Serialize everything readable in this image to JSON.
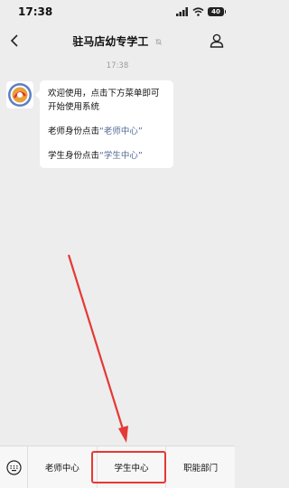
{
  "status_bar": {
    "time": "17:38",
    "battery": "40"
  },
  "nav": {
    "title": "驻马店幼专学工"
  },
  "chat": {
    "timestamp": "17:38",
    "message_lines": [
      "欢迎使用，点击下方菜单即可开始使用系统",
      "老师身份点击",
      "学生身份点击"
    ],
    "teacher_link": "“老师中心”",
    "student_link": "“学生中心”"
  },
  "menu": {
    "items": [
      "老师中心",
      "学生中心",
      "职能部门"
    ]
  },
  "colors": {
    "highlight": "#e53935",
    "link": "#576b95"
  }
}
